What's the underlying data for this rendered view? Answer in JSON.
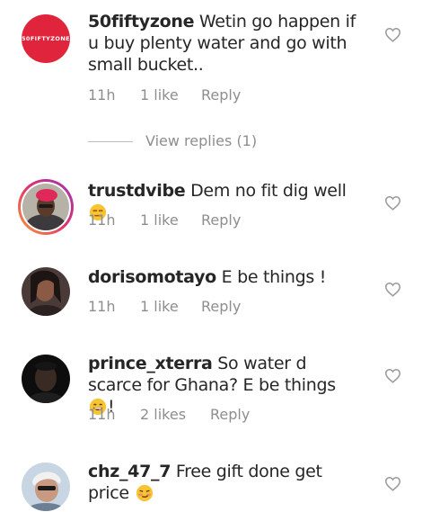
{
  "comments": [
    {
      "username": "50fiftyzone",
      "text": " Wetin go happen if u buy plenty water and go with small bucket..",
      "time": "11h",
      "likes": "1 like",
      "reply": "Reply",
      "avatar_logo_text": "50FIFTYZONE"
    },
    {
      "username": "trustdvibe",
      "text": " Dem no fit dig well",
      "time": "11h",
      "likes": "1 like",
      "reply": "Reply"
    },
    {
      "username": "dorisomotayo",
      "text": " E be things !",
      "time": "11h",
      "likes": "1 like",
      "reply": "Reply"
    },
    {
      "username": "prince_xterra",
      "text": " So water d scarce for Ghana? E be things ",
      "text_end": "!",
      "time": "11h",
      "likes": "2 likes",
      "reply": "Reply"
    },
    {
      "username": "chz_47_7",
      "text": " Free gift done get price "
    }
  ],
  "view_replies": "View replies (1)",
  "colors": {
    "brand_red": "#e0243b",
    "meta_gray": "#8e8e8e",
    "text": "#262626"
  },
  "icons": [
    "heart-icon",
    "unamused-emoji-icon",
    "grinning-sweat-emoji-icon",
    "smirk-emoji-icon"
  ]
}
